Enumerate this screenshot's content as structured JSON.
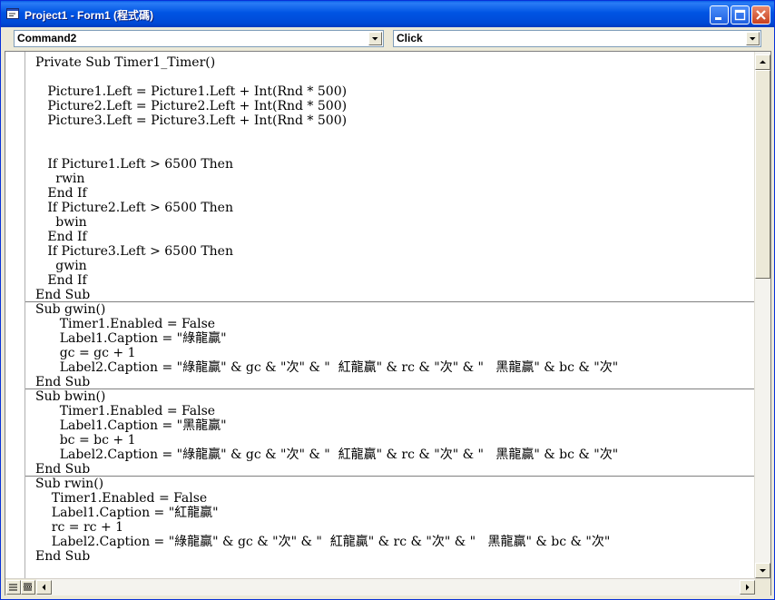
{
  "window": {
    "title": "Project1 - Form1 (程式碼)",
    "colors": {
      "titlebar": "#0054E3",
      "face": "#ECE9D8",
      "close": "#C8401E"
    },
    "icons": {
      "app": "vb-code-window-icon",
      "minimize": "minimize-icon",
      "maximize": "maximize-icon",
      "close": "close-icon"
    }
  },
  "object_combo": {
    "value": "Command2"
  },
  "procedure_combo": {
    "value": "Click"
  },
  "code_lines": [
    "Private Sub Timer1_Timer()",
    "",
    "   Picture1.Left = Picture1.Left + Int(Rnd * 500)",
    "   Picture2.Left = Picture2.Left + Int(Rnd * 500)",
    "   Picture3.Left = Picture3.Left + Int(Rnd * 500)",
    "",
    "",
    "   If Picture1.Left > 6500 Then",
    "     rwin",
    "   End If",
    "   If Picture2.Left > 6500 Then",
    "     bwin",
    "   End If",
    "   If Picture3.Left > 6500 Then",
    "     gwin",
    "   End If",
    "End Sub",
    "Sub gwin()",
    "      Timer1.Enabled = False",
    "      Label1.Caption = \"綠龍贏\"",
    "      gc = gc + 1",
    "      Label2.Caption = \"綠龍贏\" & gc & \"次\" & \"  紅龍贏\" & rc & \"次\" & \"   黑龍贏\" & bc & \"次\"",
    "End Sub",
    "Sub bwin()",
    "      Timer1.Enabled = False",
    "      Label1.Caption = \"黑龍贏\"",
    "      bc = bc + 1",
    "      Label2.Caption = \"綠龍贏\" & gc & \"次\" & \"  紅龍贏\" & rc & \"次\" & \"   黑龍贏\" & bc & \"次\"",
    "End Sub",
    "Sub rwin()",
    "    Timer1.Enabled = False",
    "    Label1.Caption = \"紅龍贏\"",
    "    rc = rc + 1",
    "    Label2.Caption = \"綠龍贏\" & gc & \"次\" & \"  紅龍贏\" & rc & \"次\" & \"   黑龍贏\" & bc & \"次\"",
    "End Sub"
  ],
  "procedure_separators_after_line": [
    16,
    22,
    28
  ],
  "icons": {
    "scroll_up": "arrow-up-icon",
    "scroll_down": "arrow-down-icon",
    "scroll_left": "arrow-left-icon",
    "scroll_right": "arrow-right-icon",
    "procedure_view": "procedure-view-icon",
    "full_module_view": "full-module-view-icon",
    "combo_dropdown": "chevron-down-icon"
  }
}
